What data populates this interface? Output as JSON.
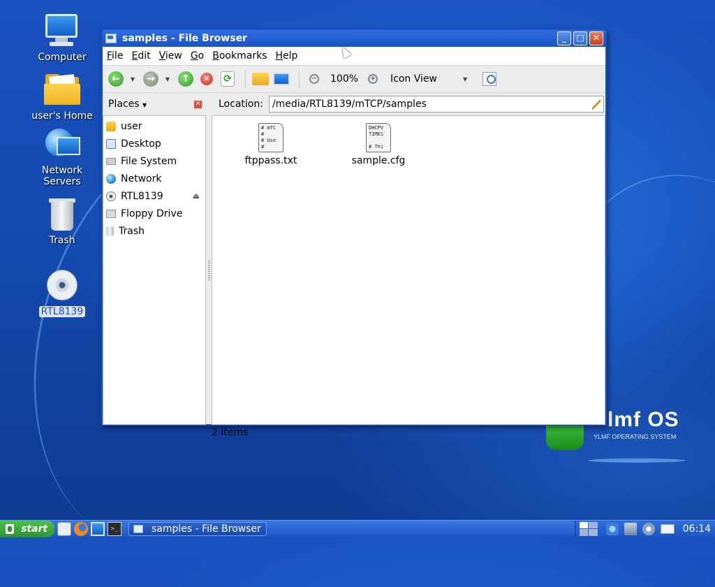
{
  "desktop": {
    "icons": [
      {
        "label": "Computer"
      },
      {
        "label": "user's Home"
      },
      {
        "label": "Network Servers"
      },
      {
        "label": "Trash"
      },
      {
        "label": "RTL8139"
      }
    ]
  },
  "window": {
    "title": "samples - File Browser",
    "controls": {
      "minimize": "_",
      "maximize": "□",
      "close": "✕"
    },
    "menu": [
      "File",
      "Edit",
      "View",
      "Go",
      "Bookmarks",
      "Help"
    ],
    "toolbar": {
      "zoom_level": "100%",
      "view_mode": "Icon View"
    },
    "places": {
      "title": "Places",
      "items": [
        {
          "label": "user",
          "icon": "folder-icon"
        },
        {
          "label": "Desktop",
          "icon": "desktop-icon"
        },
        {
          "label": "File System",
          "icon": "drive-icon"
        },
        {
          "label": "Network",
          "icon": "network-icon"
        },
        {
          "label": "RTL8139",
          "icon": "cdrom-icon"
        },
        {
          "label": "Floppy Drive",
          "icon": "floppy-icon"
        },
        {
          "label": "Trash",
          "icon": "trash-icon"
        }
      ]
    },
    "location": {
      "label": "Location:",
      "path": "/media/RTL8139/mTCP/samples"
    },
    "files": [
      {
        "name": "ftppass.txt",
        "preview": "# mTC\n#\n# Use\n#"
      },
      {
        "name": "sample.cfg",
        "preview": "DHCPV\nTIMES\n\n# Thi"
      }
    ],
    "status": "2 items"
  },
  "logo": {
    "text": "lmf OS",
    "subtitle": "YLMF OPERATING SYSTEM"
  },
  "taskbar": {
    "start_label": "start",
    "task_label": "samples - File Browser",
    "terminal_glyph": ">_",
    "clock": "06:14"
  }
}
